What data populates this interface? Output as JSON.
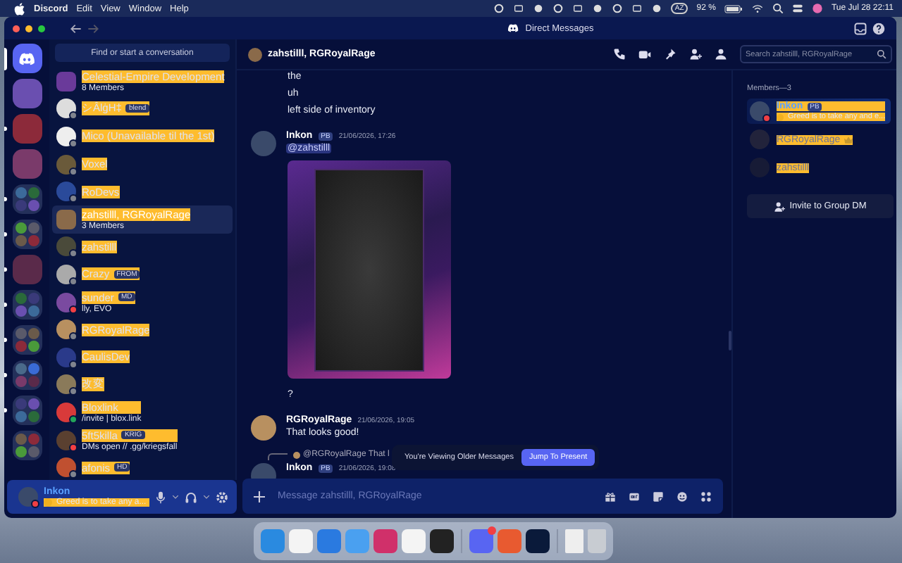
{
  "menubar": {
    "app": "Discord",
    "menus": [
      "Edit",
      "View",
      "Window",
      "Help"
    ],
    "input_source": "AZ",
    "battery": "92 %",
    "clock": "Tue Jul 28  22:11"
  },
  "window": {
    "title": "Direct Messages"
  },
  "servers": [
    {
      "kind": "home",
      "selected": true,
      "unread": false
    },
    {
      "kind": "server",
      "selected": false,
      "unread": false
    },
    {
      "kind": "server",
      "selected": false,
      "unread": true
    },
    {
      "kind": "server",
      "selected": false,
      "unread": false
    },
    {
      "kind": "folder",
      "selected": false,
      "unread": true
    },
    {
      "kind": "folder",
      "selected": false,
      "unread": true
    },
    {
      "kind": "server",
      "selected": false,
      "unread": true
    },
    {
      "kind": "folder",
      "selected": false,
      "unread": true
    },
    {
      "kind": "folder",
      "selected": false,
      "unread": true
    },
    {
      "kind": "folder",
      "selected": false,
      "unread": true
    },
    {
      "kind": "folder",
      "selected": false,
      "unread": true
    },
    {
      "kind": "folder",
      "selected": false,
      "unread": false
    }
  ],
  "dm_search": {
    "label": "Find or start a conversation"
  },
  "dms": [
    {
      "name": "Celestial-Empire Development",
      "subtitle": "8 Members",
      "kind": "group",
      "selected": false
    },
    {
      "name": "シÂlġH‡",
      "badge": "blend",
      "color": "#80848e",
      "selected": false
    },
    {
      "name": "Mico (Unavailable til the 1st)",
      "color": "#80848e",
      "selected": false
    },
    {
      "name": "Voxel",
      "color": "#80848e",
      "selected": false
    },
    {
      "name": "RoDevs",
      "color": "#80848e",
      "selected": false
    },
    {
      "name": "zahstilll, RGRoyalRage",
      "subtitle": "3 Members",
      "kind": "group",
      "selected": true
    },
    {
      "name": "zahstilll",
      "color": "#80848e",
      "selected": false
    },
    {
      "name": "Crazy",
      "badge": "FROM",
      "color": "#80848e",
      "selected": false
    },
    {
      "name": "sunder",
      "badge": "MD",
      "subtitle": "lly, EVO",
      "color": "#f23f43",
      "selected": false
    },
    {
      "name": "RGRoyalRage",
      "color": "#80848e",
      "selected": false
    },
    {
      "name": "CaulisDev",
      "color": "#80848e",
      "selected": false
    },
    {
      "name": "改変",
      "color": "#80848e",
      "selected": false
    },
    {
      "name": "Bloxlink",
      "subtitle": "/invite | blox.link",
      "color": "#23a55a",
      "selected": false
    },
    {
      "name": "5ft5killa",
      "badge": "KRIG",
      "subtitle": "DMs open // .gg/kriegsfall",
      "color": "#f23f43",
      "selected": false
    },
    {
      "name": "afonis",
      "badge": "HD",
      "color": "#80848e",
      "selected": false
    }
  ],
  "user_panel": {
    "name": "Inkon",
    "status_text": "Greed is to take any a...",
    "color": "#f23f43"
  },
  "chat": {
    "title": "zahstilll, RGRoyalRage",
    "search_placeholder": "Search zahstilll, RGRoyalRage",
    "messages": [
      {
        "kind": "line",
        "text": "the"
      },
      {
        "kind": "line",
        "text": "uh"
      },
      {
        "kind": "line",
        "text": "left side of inventory"
      },
      {
        "kind": "message",
        "author": "Inkon",
        "tag": "PB",
        "time": "21/06/2026, 17:26",
        "text": "@zahstilll"
      },
      {
        "kind": "image"
      },
      {
        "kind": "line",
        "text": "?"
      },
      {
        "kind": "message",
        "author": "RGRoyalRage",
        "time": "21/06/2026, 19:05",
        "text": "That looks good!"
      },
      {
        "kind": "reply",
        "text": "@RGRoyalRage That l"
      },
      {
        "kind": "message",
        "author": "Inkon",
        "tag": "PB",
        "time": "21/06/2026, 19:08"
      }
    ],
    "toast": {
      "text": "You're Viewing Older Messages",
      "button": "Jump To Present"
    },
    "composer_placeholder": "Message zahstilll, RGRoyalRage"
  },
  "members": {
    "title": "Members—3",
    "list": [
      {
        "name": "Inkon",
        "tag": "PB",
        "status_text": "Greed is to take any and e...",
        "online": true,
        "owner": false
      },
      {
        "name": "RGRoyalRage",
        "online": false,
        "owner": true
      },
      {
        "name": "zahstilll",
        "online": false,
        "owner": false
      }
    ],
    "invite_button": "Invite to Group DM"
  },
  "dock": {
    "apps": [
      {
        "notified": false
      },
      {
        "notified": false
      },
      {
        "notified": false
      },
      {
        "notified": false
      },
      {
        "notified": false
      },
      {
        "notified": false
      },
      {
        "notified": false
      },
      {
        "notified": true
      },
      {
        "notified": false
      },
      {
        "notified": false
      }
    ]
  }
}
